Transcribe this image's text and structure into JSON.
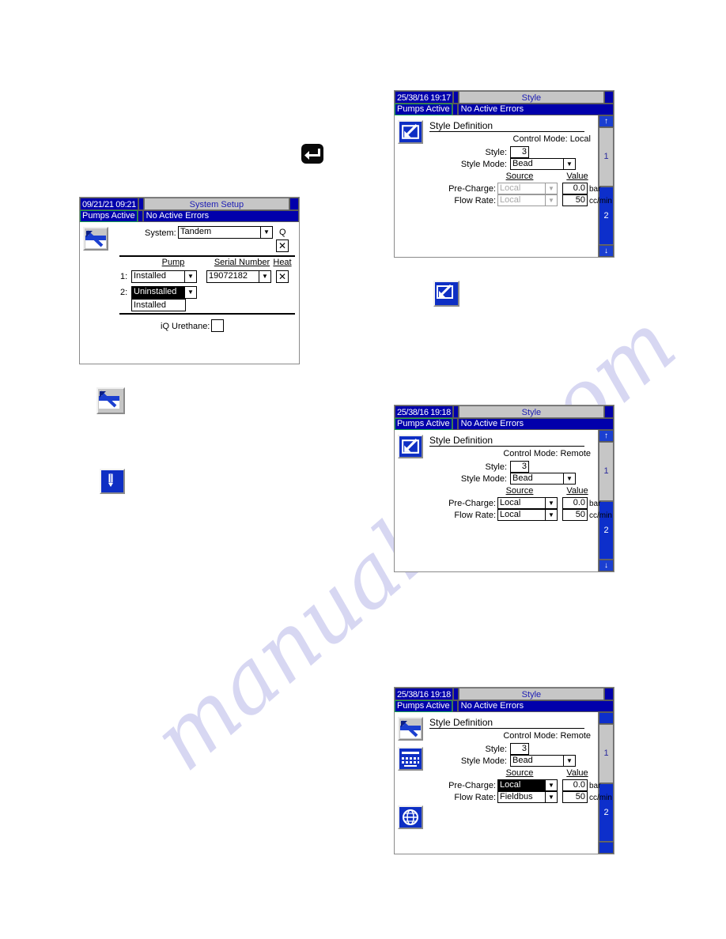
{
  "watermark": {
    "line1": "manualslib",
    "line2": ".com"
  },
  "colors": {
    "status_blue": "#0100ab",
    "tab_blue": "#0d2fcb",
    "title_gray": "#c6c6c6",
    "title_text_blue": "#1d1db4",
    "pumps_border_green": "#19a64a",
    "icon_blue": "#0e2fc4"
  },
  "enter_key_icon": {
    "name": "enter-key-icon",
    "glyph": "↵"
  },
  "figure_icons": {
    "nozzle_gray": "nozzle-setup-icon",
    "pencil_blue": "pencil-edit-icon",
    "style_blue": "style-definition-icon"
  },
  "screen_system_setup": {
    "clock": "09/21/21 09:21",
    "title": "System Setup",
    "pumps_status": "Pumps Active",
    "errors_status": "No Active Errors",
    "system_label": "System:",
    "system_value": "Tandem",
    "q_label": "Q",
    "q_checkbox": "✕",
    "columns": {
      "pump": "Pump",
      "serial": "Serial Number",
      "heat": "Heat"
    },
    "rows": [
      {
        "index": "1:",
        "pump": "Installed",
        "serial": "19072182",
        "heat": "✕"
      },
      {
        "index": "2:",
        "pump": "Uninstalled",
        "serial": "",
        "heat": ""
      }
    ],
    "open_dropdown": {
      "selected": "Uninstalled",
      "option": "Installed"
    },
    "iq_urethane_label": "iQ Urethane:",
    "iq_urethane_checked": ""
  },
  "screen_style_local": {
    "clock": "25/38/16 19:17",
    "title": "Style",
    "pumps_status": "Pumps Active",
    "errors_status": "No Active Errors",
    "heading": "Style Definition",
    "control_mode": "Control Mode: Local",
    "style_label": "Style:",
    "style_value": "3",
    "style_mode_label": "Style Mode:",
    "style_mode_value": "Bead",
    "col_source": "Source",
    "col_value": "Value",
    "precharge_label": "Pre-Charge:",
    "precharge_source": "Local",
    "precharge_value": "0.0",
    "precharge_unit": "bar",
    "flowrate_label": "Flow Rate:",
    "flowrate_source": "Local",
    "flowrate_value": "50",
    "flowrate_unit": "cc/min",
    "tabs": [
      "1",
      "2"
    ],
    "arrow_up": "↑",
    "arrow_down": "↓"
  },
  "screen_style_remote": {
    "clock": "25/38/16 19:18",
    "title": "Style",
    "pumps_status": "Pumps Active",
    "errors_status": "No Active Errors",
    "heading": "Style Definition",
    "control_mode": "Control Mode: Remote",
    "style_label": "Style:",
    "style_value": "3",
    "style_mode_label": "Style Mode:",
    "style_mode_value": "Bead",
    "col_source": "Source",
    "col_value": "Value",
    "precharge_label": "Pre-Charge:",
    "precharge_source": "Local",
    "precharge_value": "0.0",
    "precharge_unit": "bar",
    "flowrate_label": "Flow Rate:",
    "flowrate_source": "Local",
    "flowrate_value": "50",
    "flowrate_unit": "cc/min",
    "tabs": [
      "1",
      "2"
    ],
    "arrow_up": "↑",
    "arrow_down": "↓"
  },
  "screen_style_fieldbus": {
    "clock": "25/38/16 19:18",
    "title": "Style",
    "pumps_status": "Pumps Active",
    "errors_status": "No Active Errors",
    "heading": "Style Definition",
    "control_mode": "Control Mode: Remote",
    "style_label": "Style:",
    "style_value": "3",
    "style_mode_label": "Style Mode:",
    "style_mode_value": "Bead",
    "col_source": "Source",
    "col_value": "Value",
    "precharge_label": "Pre-Charge:",
    "precharge_source": "Local",
    "precharge_value": "0.0",
    "precharge_unit": "bar",
    "flowrate_label": "Flow Rate:",
    "flowrate_source": "Fieldbus",
    "flowrate_value": "50",
    "flowrate_unit": "cc/min",
    "tabs": [
      "1",
      "2"
    ],
    "rail_icons": [
      "nozzle-setup-icon",
      "keyboard-icon",
      "globe-icon"
    ]
  }
}
